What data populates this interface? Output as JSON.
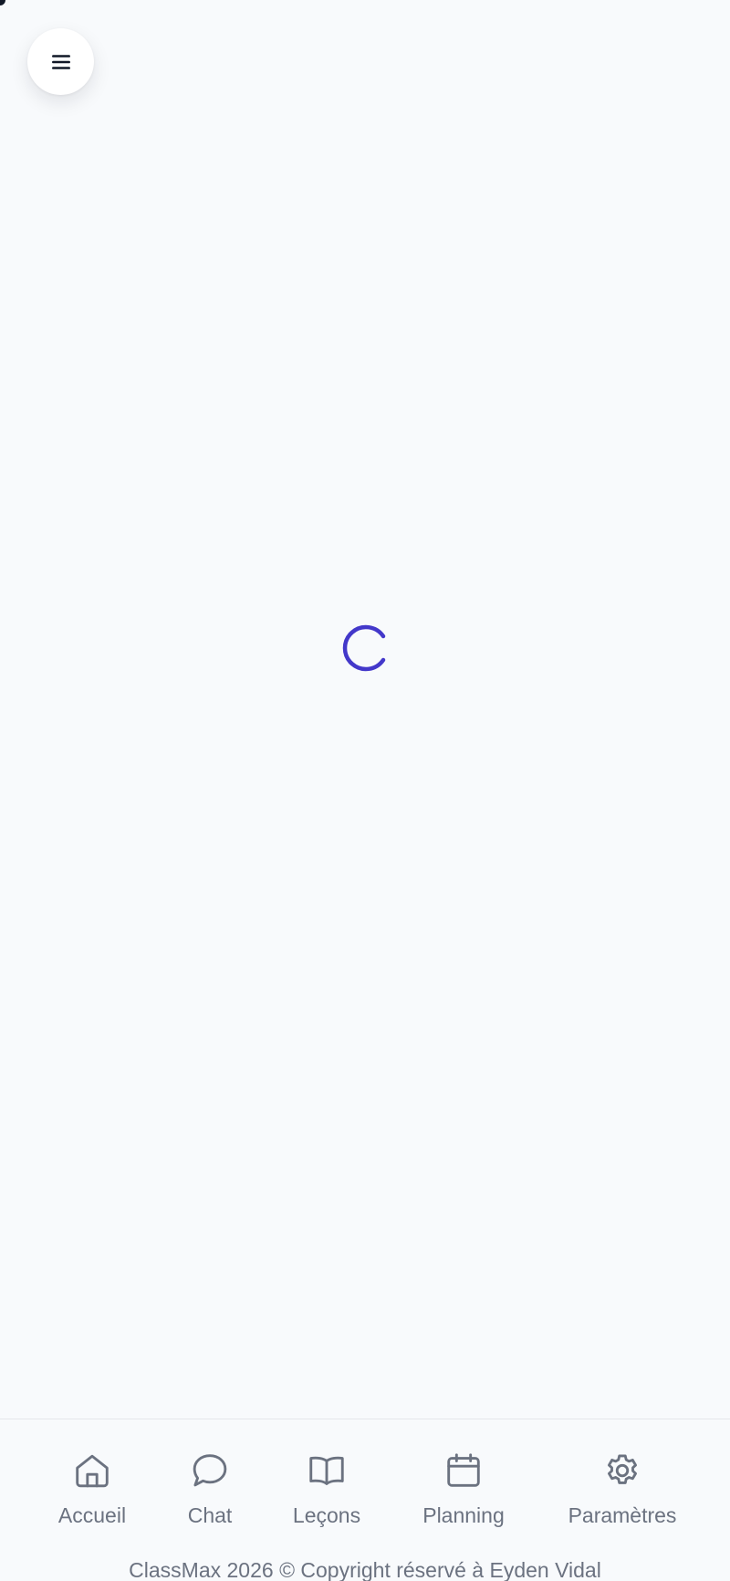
{
  "menu_button": {
    "icon": "hamburger-menu-icon"
  },
  "loading": {
    "icon": "spinner-icon",
    "color": "#4338ca"
  },
  "bottom_nav": {
    "items": [
      {
        "label": "Accueil",
        "icon": "home-icon"
      },
      {
        "label": "Chat",
        "icon": "chat-bubble-icon"
      },
      {
        "label": "Leçons",
        "icon": "book-open-icon"
      },
      {
        "label": "Planning",
        "icon": "calendar-icon"
      },
      {
        "label": "Paramètres",
        "icon": "gear-icon"
      }
    ],
    "icon_color": "#6b7280"
  },
  "footer": {
    "text": "ClassMax 2026 © Copyright réservé à Eyden Vidal"
  }
}
